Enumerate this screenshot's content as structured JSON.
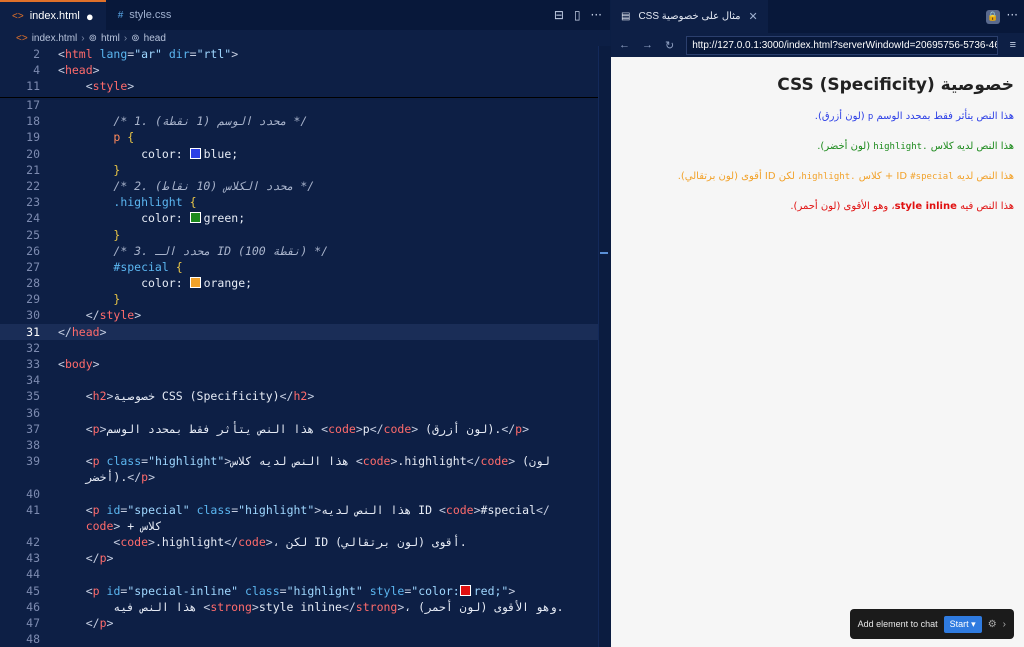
{
  "editor": {
    "tabs": [
      {
        "label": "index.html",
        "active": true,
        "modified": "●"
      },
      {
        "label": "style.css"
      }
    ],
    "breadcrumb": {
      "file": "index.html",
      "html": "html",
      "head": "head"
    },
    "icons": {
      "html_glyph": "<>",
      "css_glyph": "#",
      "element_glyph": "⊚",
      "split_icon": "⊟",
      "layout_icon": "▯",
      "more_icon": "···"
    }
  },
  "code": {
    "l2": {
      "n": "2",
      "tag": "html",
      "a1": "lang",
      "v1": "\"ar\"",
      "a2": "dir",
      "v2": "\"rtl\""
    },
    "l4": {
      "n": "4",
      "tag": "head"
    },
    "l11": {
      "n": "11",
      "tag": "style"
    },
    "l17": {
      "n": "17"
    },
    "l18": {
      "n": "18",
      "comment": "/* 1. محدد الوسم (1 نقطة) */"
    },
    "l19": {
      "n": "19",
      "sel": "p",
      "brace": "{"
    },
    "l20": {
      "n": "20",
      "prop": "color:",
      "val": "blue;",
      "swatch": "#2c3fe6"
    },
    "l21": {
      "n": "21",
      "brace": "}"
    },
    "l22": {
      "n": "22",
      "comment": "/* 2. محدد الكلاس (10 نقاط) */"
    },
    "l23": {
      "n": "23",
      "sel": ".highlight",
      "brace": "{"
    },
    "l24": {
      "n": "24",
      "prop": "color:",
      "val": "green;",
      "swatch": "#1c8a1c"
    },
    "l25": {
      "n": "25",
      "brace": "}"
    },
    "l26": {
      "n": "26",
      "comment": "/* 3. محدد الـ ID (100 نقطة) */"
    },
    "l27": {
      "n": "27",
      "sel": "#special",
      "brace": "{"
    },
    "l28": {
      "n": "28",
      "prop": "color:",
      "val": "orange;",
      "swatch": "#f2a22a"
    },
    "l29": {
      "n": "29",
      "brace": "}"
    },
    "l30": {
      "n": "30",
      "tag": "style"
    },
    "l31": {
      "n": "31",
      "tag": "head"
    },
    "l32": {
      "n": "32"
    },
    "l33": {
      "n": "33",
      "tag": "body"
    },
    "l34": {
      "n": "34"
    },
    "l35": {
      "n": "35",
      "tag": "h2",
      "text": "خصوصية CSS (Specificity)"
    },
    "l36": {
      "n": "36"
    },
    "l37": {
      "n": "37",
      "tag": "p",
      "text1": "هذا النص يتأثر فقط بمحدد الوسم",
      "code": "p",
      "text2": "(لون أزرق)."
    },
    "l38": {
      "n": "38"
    },
    "l39": {
      "n": "39",
      "tag": "p",
      "a1": "class",
      "v1": "\"highlight\"",
      "text1": "هذا النص لديه كلاس",
      "code": ".highlight",
      "text2": "(لون"
    },
    "l39b": {
      "text": "أخضر)."
    },
    "l40": {
      "n": "40"
    },
    "l41": {
      "n": "41",
      "tag": "p",
      "a1": "id",
      "v1": "\"special\"",
      "a2": "class",
      "v2": "\"highlight\"",
      "text1": "هذا النص لديه ID",
      "code": "#special"
    },
    "l41b": {
      "text": "+ كلاس"
    },
    "l42": {
      "n": "42",
      "code": ".highlight",
      "text": "، لكن ID أقوى (لون برتقالي)."
    },
    "l43": {
      "n": "43"
    },
    "l44": {
      "n": "44"
    },
    "l45": {
      "n": "45",
      "tag": "p",
      "a1": "id",
      "v1": "\"special-inline\"",
      "a2": "class",
      "v2": "\"highlight\"",
      "a3": "style",
      "v3a": "\"color:",
      "v3b": "red;\"",
      "swatch": "#e01010"
    },
    "l46": {
      "n": "46",
      "text1": "هذا النص فيه",
      "strong": "style inline",
      "text2": "، وهو الأقوى (لون أحمر)."
    },
    "l47": {
      "n": "47"
    },
    "l48": {
      "n": "48"
    }
  },
  "browser": {
    "tab_title": "CSS مثال على خصوصية",
    "url": "http://127.0.0.1:3000/index.html?serverWindowId=20695756-5736-46",
    "nav": {
      "back": "←",
      "forward": "→",
      "reload": "↻",
      "close": "✕",
      "lock": "🔒",
      "hamburger": "≡",
      "page_glyph": "▤"
    },
    "page": {
      "title": "خصوصية CSS (Specificity)",
      "p1": {
        "t1": "هذا النص يتأثر فقط بمحدد الوسم",
        "code": "p",
        "t2": "(لون أزرق).",
        "color": "#2c3fe6"
      },
      "p2": {
        "t1": "هذا النص لديه كلاس",
        "code": ".highlight",
        "t2": "(لون أخضر).",
        "color": "#1c8a1c"
      },
      "p3": {
        "t1": "هذا النص لديه ID",
        "code1": "#special",
        "t2": "+ كلاس",
        "code2": ".highlight",
        "t3": "، لكن ID أقوى (لون برتقالي).",
        "color": "#f2a22a"
      },
      "p4": {
        "t1": "هذا النص فيه",
        "strong": "style inline",
        "t2": "، وهو الأقوى (لون أحمر).",
        "color": "#e01010"
      }
    },
    "chat": {
      "label": "Add element to chat",
      "start": "Start",
      "caret": "▾",
      "gear": "⚙",
      "chev": "›"
    }
  }
}
